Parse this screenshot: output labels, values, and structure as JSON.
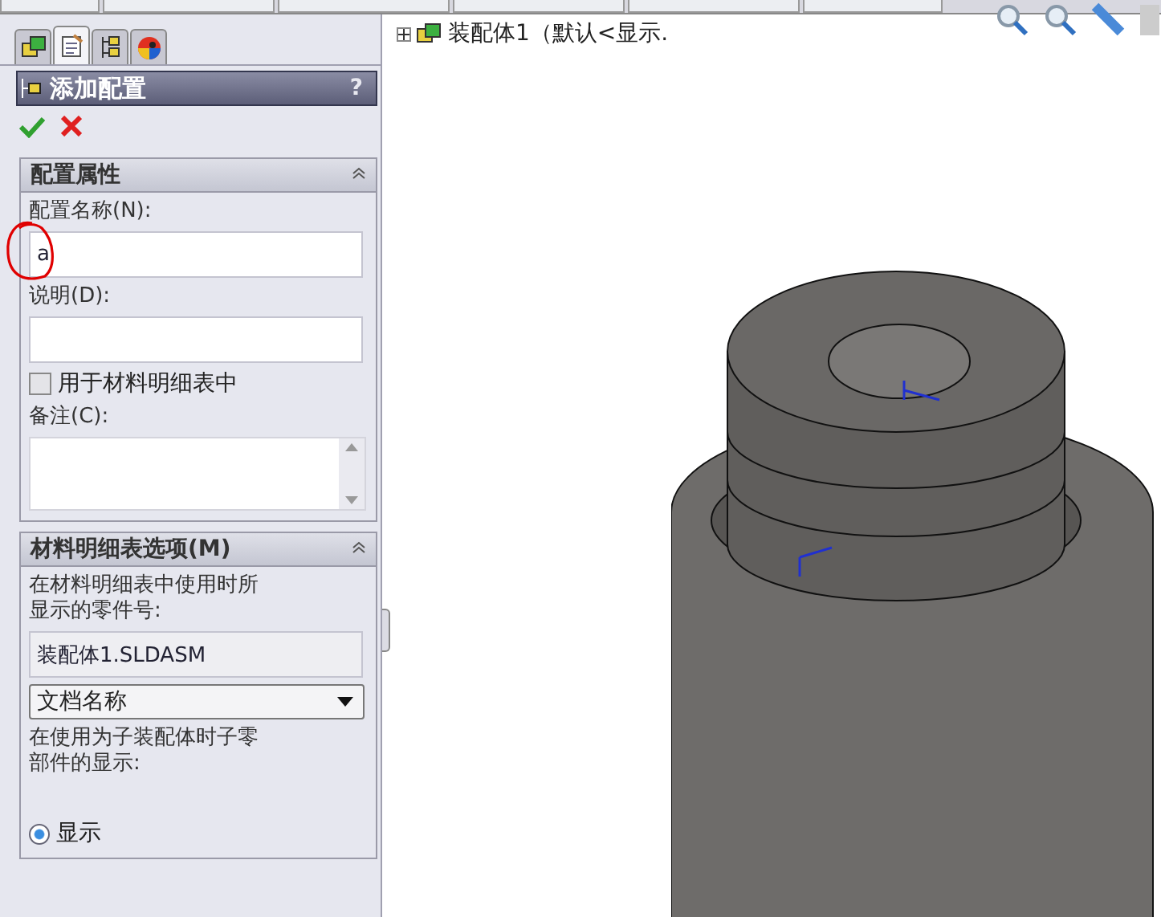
{
  "panel_tabs": [
    {
      "kind": "features",
      "selected": false
    },
    {
      "kind": "properties",
      "selected": true
    },
    {
      "kind": "configurations",
      "selected": false
    },
    {
      "kind": "appearance",
      "selected": false
    }
  ],
  "panel": {
    "title": "添加配置",
    "help": "?"
  },
  "config_properties": {
    "title": "配置属性",
    "expanded": true,
    "name_label": "配置名称(N):",
    "name_value": "a",
    "description_label": "说明(D):",
    "bom_checkbox": {
      "label": "用于材料明细表中",
      "checked": false
    },
    "comment_label": "备注(C):"
  },
  "bom_options": {
    "title": "材料明细表选项(M)",
    "expanded": true,
    "part_number_label": "在材料明细表中使用时所显示的零件号:",
    "part_number_value": "装配体1.SLDASM",
    "dropdown_value": "文档名称",
    "child_display_label": "在使用为子装配体时子零部件的显示:",
    "radios": [
      {
        "label": "显示",
        "selected": true
      }
    ]
  },
  "tree": {
    "label": "装配体1（默认<显示.",
    "expanded": false
  }
}
